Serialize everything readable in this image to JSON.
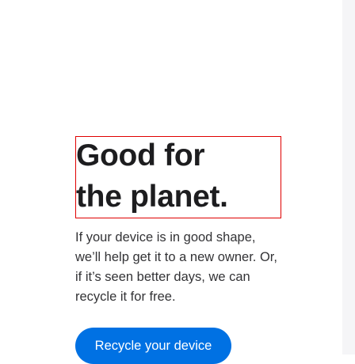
{
  "heading": {
    "line1": "Good for",
    "line2": "the planet."
  },
  "description": "If your device is in good shape, we’ll help get it to a new owner. Or, if it’s seen better days, we can recycle it for free.",
  "button": {
    "label": "Recycle your device"
  },
  "colors": {
    "accent": "#0071e3",
    "highlight_border": "#e00000"
  }
}
